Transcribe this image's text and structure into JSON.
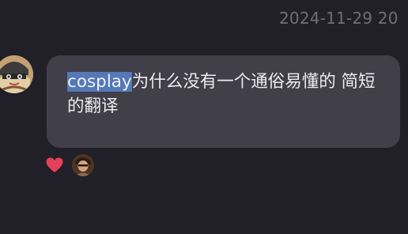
{
  "chat": {
    "timestamp": "2024-11-29 20",
    "message": {
      "highlighted": "cosplay",
      "text": "为什么没有一个通俗易懂的 简短的翻译"
    },
    "reactions": [
      {
        "icon": "heart-icon",
        "color": "#e5405a"
      }
    ],
    "colors": {
      "background": "#212028",
      "bubble": "#403f4a",
      "selection": "#5578b6"
    }
  }
}
